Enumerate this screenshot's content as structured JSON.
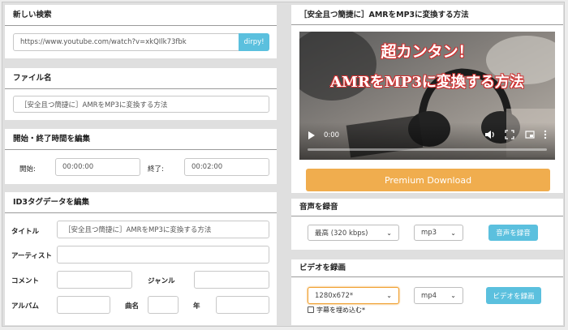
{
  "left": {
    "new_search": {
      "title": "新しい検索",
      "url_value": "https://www.youtube.com/watch?v=xkQIlk73fbk",
      "button_label": "dirpy!"
    },
    "filename": {
      "title": "ファイル名",
      "value": "［安全且つ簡捷に］AMRをMP3に変換する方法"
    },
    "time": {
      "title": "開始・終了時間を編集",
      "start_label": "開始:",
      "start_value": "00:00:00",
      "end_label": "終了:",
      "end_value": "00:02:00"
    },
    "id3": {
      "title": "ID3タグデータを編集",
      "title_label": "タイトル",
      "title_value": "［安全且つ簡捷に］AMRをMP3に変換する方法",
      "artist_label": "アーティスト",
      "comment_label": "コメント",
      "genre_label": "ジャンル",
      "album_label": "アルバム",
      "track_label": "曲名",
      "year_label": "年"
    }
  },
  "right": {
    "video": {
      "title": "［安全且つ簡捷に］AMRをMP3に変換する方法",
      "overlay_line1": "超カンタン！",
      "overlay_line2": "AMRをMP3に変換する方法",
      "time": "0:00",
      "progress": 0
    },
    "premium_label": "Premium Download",
    "audio": {
      "title": "音声を録音",
      "quality": "最高 (320 kbps)",
      "format": "mp3",
      "button_label": "音声を録音"
    },
    "videorec": {
      "title": "ビデオを録画",
      "resolution": "1280x672*",
      "format": "mp4",
      "button_label": "ビデオを録画",
      "subtitle_label": "字幕を埋め込む*"
    }
  },
  "colors": {
    "accent_blue": "#5bc0de",
    "premium_orange": "#f0ad4e",
    "highlight_orange": "#f0a030",
    "overlay_text": "#ffffff",
    "overlay_stroke": "#e03030"
  }
}
